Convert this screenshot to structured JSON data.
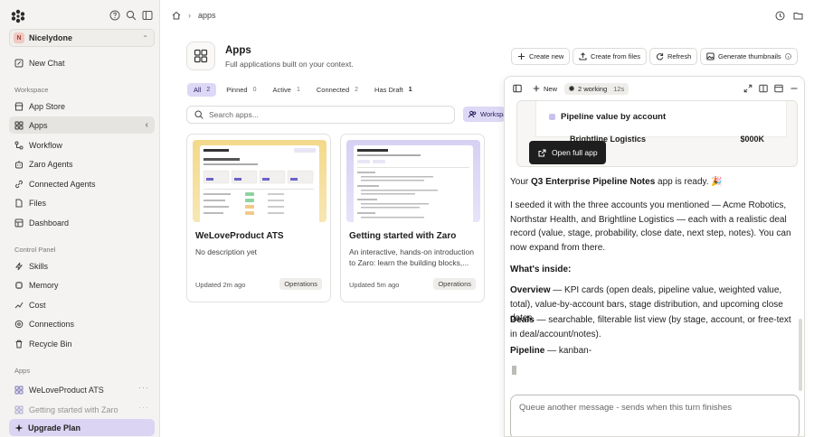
{
  "sidebar": {
    "workspace_initial": "N",
    "workspace_name": "Nicelydone",
    "new_chat": "New Chat",
    "section_workspace": "Workspace",
    "items": [
      {
        "label": "App Store",
        "icon": "store-icon"
      },
      {
        "label": "Apps",
        "icon": "apps-icon"
      },
      {
        "label": "Workflow",
        "icon": "workflow-icon"
      },
      {
        "label": "Zaro Agents",
        "icon": "agents-icon"
      },
      {
        "label": "Connected Agents",
        "icon": "connected-agents-icon"
      },
      {
        "label": "Files",
        "icon": "files-icon"
      },
      {
        "label": "Dashboard",
        "icon": "dashboard-icon"
      }
    ],
    "section_control": "Control Panel",
    "control_items": [
      {
        "label": "Skills",
        "icon": "skills-icon"
      },
      {
        "label": "Memory",
        "icon": "memory-icon"
      },
      {
        "label": "Cost",
        "icon": "cost-icon"
      },
      {
        "label": "Connections",
        "icon": "connections-icon"
      },
      {
        "label": "Recycle Bin",
        "icon": "trash-icon"
      }
    ],
    "section_apps": "Apps",
    "app_items": [
      {
        "label": "WeLoveProduct ATS"
      },
      {
        "label": "Getting started with Zaro"
      }
    ],
    "upgrade": "Upgrade Plan"
  },
  "breadcrumb": {
    "current": "apps"
  },
  "header": {
    "title": "Apps",
    "subtitle": "Full applications built on your context.",
    "actions": {
      "create_new": "Create new",
      "create_from_files": "Create from files",
      "refresh": "Refresh",
      "generate_thumbnails": "Generate thumbnails"
    }
  },
  "filters": [
    {
      "label": "All",
      "count": "2"
    },
    {
      "label": "Pinned",
      "count": "0"
    },
    {
      "label": "Active",
      "count": "1"
    },
    {
      "label": "Connected",
      "count": "2"
    },
    {
      "label": "Has Draft",
      "count": "1"
    }
  ],
  "search": {
    "placeholder": "Search apps...",
    "workspace_filter": "Workspace"
  },
  "cards": [
    {
      "title": "WeLoveProduct ATS",
      "description": "No description yet",
      "updated": "Updated 2m ago",
      "tag": "Operations"
    },
    {
      "title": "Getting started with Zaro",
      "description": "An interactive, hands-on introduction to Zaro: learn the building blocks,...",
      "updated": "Updated 5m ago",
      "tag": "Operations"
    }
  ],
  "chat": {
    "new_label": "New",
    "working_label": "2 working",
    "working_time": "12s",
    "preview_title": "Pipeline value by account",
    "preview_cut_left": "Brightline Logistics",
    "preview_cut_right": "$000K",
    "open_full_app": "Open full app",
    "msg1_pre": "Your ",
    "msg1_bold": "Q3 Enterprise Pipeline Notes",
    "msg1_post": " app is ready. 🎉",
    "msg2": "I seeded it with the three accounts you mentioned — Acme Robotics, Northstar Health, and Brightline Logistics — each with a realistic deal record (value, stage, probability, close date, next step, notes). You can now expand from there.",
    "whats_inside": "What's inside:",
    "overview_label": "Overview",
    "overview_text": " — KPI cards (open deals, pipeline value, weighted value, total), value-by-account bars, stage distribution, and upcoming close dates.",
    "deals_label": "Deals",
    "deals_text": " — searchable, filterable list view (by stage, account, or free-text in deal/account/notes).",
    "pipeline_label": "Pipeline",
    "pipeline_text": " — kanban-",
    "composer_placeholder": "Queue another message - sends when this turn finishes"
  },
  "colors": {
    "accent": "#ddd8f5",
    "upgrade_bg": "#dcd4f3",
    "sidebar_bg": "#f4f3f1",
    "dark_button": "#1e1e1e"
  }
}
